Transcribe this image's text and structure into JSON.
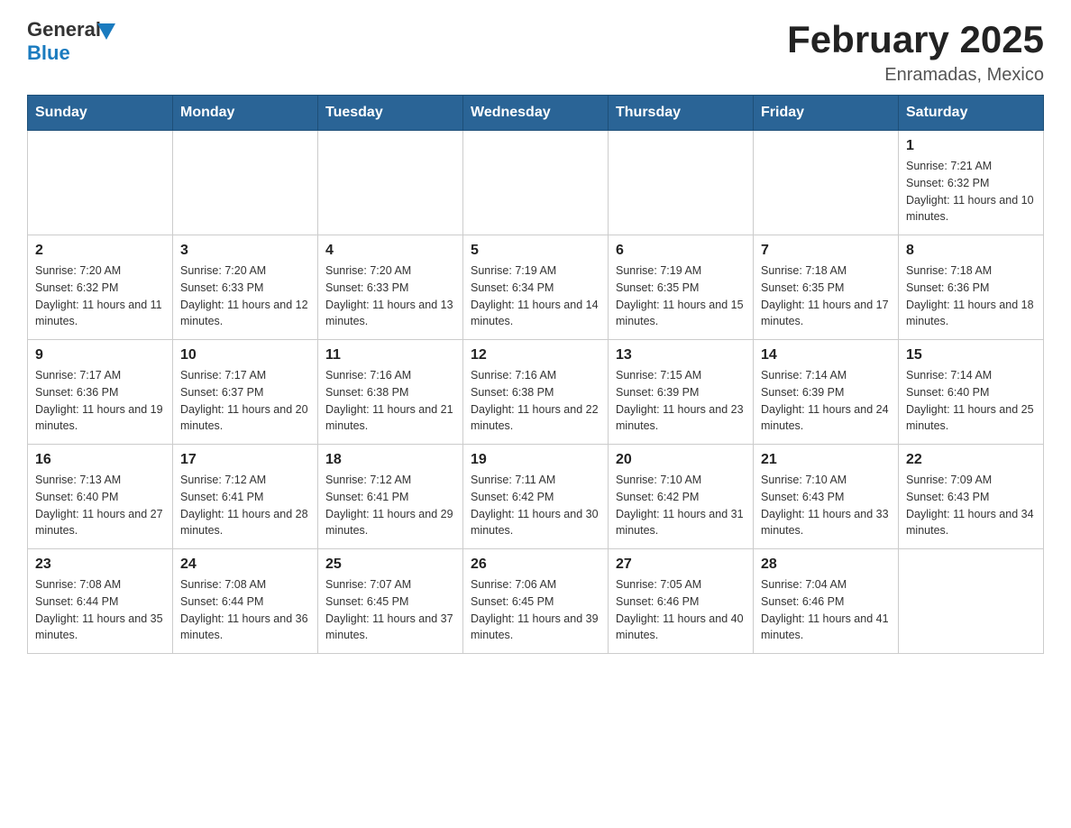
{
  "header": {
    "logo_general": "General",
    "logo_blue": "Blue",
    "month_year": "February 2025",
    "location": "Enramadas, Mexico"
  },
  "weekdays": [
    "Sunday",
    "Monday",
    "Tuesday",
    "Wednesday",
    "Thursday",
    "Friday",
    "Saturday"
  ],
  "weeks": [
    [
      {
        "day": "",
        "info": ""
      },
      {
        "day": "",
        "info": ""
      },
      {
        "day": "",
        "info": ""
      },
      {
        "day": "",
        "info": ""
      },
      {
        "day": "",
        "info": ""
      },
      {
        "day": "",
        "info": ""
      },
      {
        "day": "1",
        "info": "Sunrise: 7:21 AM\nSunset: 6:32 PM\nDaylight: 11 hours and 10 minutes."
      }
    ],
    [
      {
        "day": "2",
        "info": "Sunrise: 7:20 AM\nSunset: 6:32 PM\nDaylight: 11 hours and 11 minutes."
      },
      {
        "day": "3",
        "info": "Sunrise: 7:20 AM\nSunset: 6:33 PM\nDaylight: 11 hours and 12 minutes."
      },
      {
        "day": "4",
        "info": "Sunrise: 7:20 AM\nSunset: 6:33 PM\nDaylight: 11 hours and 13 minutes."
      },
      {
        "day": "5",
        "info": "Sunrise: 7:19 AM\nSunset: 6:34 PM\nDaylight: 11 hours and 14 minutes."
      },
      {
        "day": "6",
        "info": "Sunrise: 7:19 AM\nSunset: 6:35 PM\nDaylight: 11 hours and 15 minutes."
      },
      {
        "day": "7",
        "info": "Sunrise: 7:18 AM\nSunset: 6:35 PM\nDaylight: 11 hours and 17 minutes."
      },
      {
        "day": "8",
        "info": "Sunrise: 7:18 AM\nSunset: 6:36 PM\nDaylight: 11 hours and 18 minutes."
      }
    ],
    [
      {
        "day": "9",
        "info": "Sunrise: 7:17 AM\nSunset: 6:36 PM\nDaylight: 11 hours and 19 minutes."
      },
      {
        "day": "10",
        "info": "Sunrise: 7:17 AM\nSunset: 6:37 PM\nDaylight: 11 hours and 20 minutes."
      },
      {
        "day": "11",
        "info": "Sunrise: 7:16 AM\nSunset: 6:38 PM\nDaylight: 11 hours and 21 minutes."
      },
      {
        "day": "12",
        "info": "Sunrise: 7:16 AM\nSunset: 6:38 PM\nDaylight: 11 hours and 22 minutes."
      },
      {
        "day": "13",
        "info": "Sunrise: 7:15 AM\nSunset: 6:39 PM\nDaylight: 11 hours and 23 minutes."
      },
      {
        "day": "14",
        "info": "Sunrise: 7:14 AM\nSunset: 6:39 PM\nDaylight: 11 hours and 24 minutes."
      },
      {
        "day": "15",
        "info": "Sunrise: 7:14 AM\nSunset: 6:40 PM\nDaylight: 11 hours and 25 minutes."
      }
    ],
    [
      {
        "day": "16",
        "info": "Sunrise: 7:13 AM\nSunset: 6:40 PM\nDaylight: 11 hours and 27 minutes."
      },
      {
        "day": "17",
        "info": "Sunrise: 7:12 AM\nSunset: 6:41 PM\nDaylight: 11 hours and 28 minutes."
      },
      {
        "day": "18",
        "info": "Sunrise: 7:12 AM\nSunset: 6:41 PM\nDaylight: 11 hours and 29 minutes."
      },
      {
        "day": "19",
        "info": "Sunrise: 7:11 AM\nSunset: 6:42 PM\nDaylight: 11 hours and 30 minutes."
      },
      {
        "day": "20",
        "info": "Sunrise: 7:10 AM\nSunset: 6:42 PM\nDaylight: 11 hours and 31 minutes."
      },
      {
        "day": "21",
        "info": "Sunrise: 7:10 AM\nSunset: 6:43 PM\nDaylight: 11 hours and 33 minutes."
      },
      {
        "day": "22",
        "info": "Sunrise: 7:09 AM\nSunset: 6:43 PM\nDaylight: 11 hours and 34 minutes."
      }
    ],
    [
      {
        "day": "23",
        "info": "Sunrise: 7:08 AM\nSunset: 6:44 PM\nDaylight: 11 hours and 35 minutes."
      },
      {
        "day": "24",
        "info": "Sunrise: 7:08 AM\nSunset: 6:44 PM\nDaylight: 11 hours and 36 minutes."
      },
      {
        "day": "25",
        "info": "Sunrise: 7:07 AM\nSunset: 6:45 PM\nDaylight: 11 hours and 37 minutes."
      },
      {
        "day": "26",
        "info": "Sunrise: 7:06 AM\nSunset: 6:45 PM\nDaylight: 11 hours and 39 minutes."
      },
      {
        "day": "27",
        "info": "Sunrise: 7:05 AM\nSunset: 6:46 PM\nDaylight: 11 hours and 40 minutes."
      },
      {
        "day": "28",
        "info": "Sunrise: 7:04 AM\nSunset: 6:46 PM\nDaylight: 11 hours and 41 minutes."
      },
      {
        "day": "",
        "info": ""
      }
    ]
  ]
}
